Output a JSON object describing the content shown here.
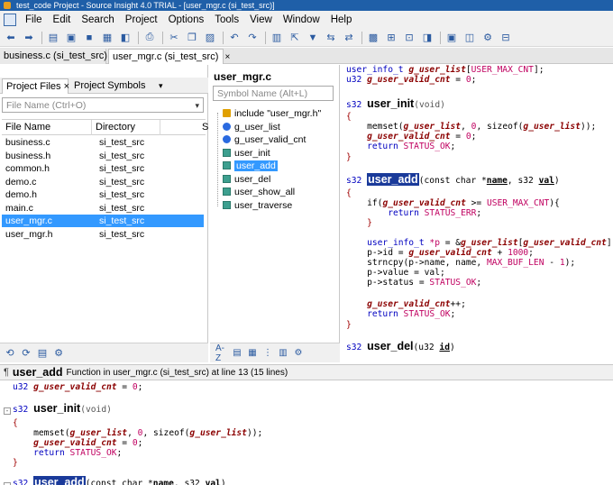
{
  "window": {
    "title": "test_code Project - Source Insight 4.0 TRIAL - [user_mgr.c (si_test_src)]"
  },
  "menu": [
    "File",
    "Edit",
    "Search",
    "Project",
    "Options",
    "Tools",
    "View",
    "Window",
    "Help"
  ],
  "toolbar_icons": [
    "back-icon",
    "forward-icon",
    "new-file-icon",
    "open-folder-icon",
    "save-icon",
    "save-all-icon",
    "close-file-icon",
    "print-icon",
    "cut-icon",
    "copy-icon",
    "paste-icon",
    "undo-icon",
    "redo-icon",
    "symbol-window-icon",
    "jump-icon",
    "bookmark-icon",
    "replace-icon",
    "browse-icon",
    "lookup-icon",
    "relation-icon",
    "sync-icon",
    "context-icon",
    "project-icon",
    "options-icon",
    "settings-icon",
    "layout-icon"
  ],
  "file_tabs": [
    {
      "label": "business.c (si_test_src)"
    },
    {
      "label": "user_mgr.c (si_test_src)",
      "close": "×"
    }
  ],
  "left_panel": {
    "tabs": {
      "project_files": "Project Files",
      "close": "×",
      "project_symbols": "Project Symbols",
      "more": "▾"
    },
    "search_placeholder": "File Name (Ctrl+O)",
    "dropdown": "▾",
    "columns": {
      "name": "File Name",
      "directory": "Directory",
      "s": "S"
    },
    "files": [
      {
        "name": "business.c",
        "dir": "si_test_src"
      },
      {
        "name": "business.h",
        "dir": "si_test_src"
      },
      {
        "name": "common.h",
        "dir": "si_test_src"
      },
      {
        "name": "demo.c",
        "dir": "si_test_src"
      },
      {
        "name": "demo.h",
        "dir": "si_test_src"
      },
      {
        "name": "main.c",
        "dir": "si_test_src"
      },
      {
        "name": "user_mgr.c",
        "dir": "si_test_src"
      },
      {
        "name": "user_mgr.h",
        "dir": "si_test_src"
      }
    ],
    "selected_index": 6
  },
  "symbol_panel": {
    "title": "user_mgr.c",
    "search_placeholder": "Symbol Name (Alt+L)",
    "symbols": [
      {
        "label": "include \"user_mgr.h\"",
        "kind": "include"
      },
      {
        "label": "g_user_list",
        "kind": "var"
      },
      {
        "label": "g_user_valid_cnt",
        "kind": "var"
      },
      {
        "label": "user_init",
        "kind": "fn"
      },
      {
        "label": "user_add",
        "kind": "fn"
      },
      {
        "label": "user_del",
        "kind": "fn"
      },
      {
        "label": "user_show_all",
        "kind": "fn"
      },
      {
        "label": "user_traverse",
        "kind": "fn"
      }
    ],
    "selected_index": 4,
    "sort_label": "A-Z"
  },
  "code": {
    "l1a": "user_info_t ",
    "l1b": "g_user_list",
    "l1c": "[",
    "l1d": "USER_MAX_CNT",
    "l1e": "];",
    "l2a": "u32 ",
    "l2b": "g_user_valid_cnt",
    "l2c": " = ",
    "l2d": "0",
    "l2e": ";",
    "init_ret": "s32 ",
    "init_name": "user_init",
    "init_params": "(void)",
    "ob": "{",
    "cb": "}",
    "m1a": "    memset(",
    "m1b": "g_user_list",
    "m1c": ", ",
    "m1d": "0",
    "m1e": ", sizeof(",
    "m1f": "g_user_list",
    "m1g": "));",
    "m2a": "    ",
    "m2b": "g_user_valid_cnt",
    "m2c": " = ",
    "m2d": "0",
    "m2e": ";",
    "m3a": "    return ",
    "m3b": "STATUS_OK",
    "m3c": ";",
    "add_ret": "s32 ",
    "add_name": "user_add",
    "add_p1": "(const char *",
    "add_p2": "name",
    "add_p3": ", s32 ",
    "add_p4": "val",
    "add_p5": ")",
    "a1a": "    if(",
    "a1b": "g_user_valid_cnt",
    "a1c": " >= ",
    "a1d": "USER_MAX_CNT",
    "a1e": "){",
    "a2a": "        return ",
    "a2b": "STATUS_ERR",
    "a2c": ";",
    "a3": "    }",
    "a4a": "    user_info_t ",
    "a4b": "*p",
    "a4c": " = &",
    "a4d": "g_user_list",
    "a4e": "[",
    "a4f": "g_user_valid_cnt",
    "a4g": "];",
    "a5a": "    p->id = ",
    "a5b": "g_user_valid_cnt",
    "a5c": " + ",
    "a5d": "1000",
    "a5e": ";",
    "a6a": "    strncpy(p->name, name, ",
    "a6b": "MAX_BUF_LEN",
    "a6c": " - ",
    "a6d": "1",
    "a6e": ");",
    "a7": "    p->value = val;",
    "a8a": "    p->status = ",
    "a8b": "STATUS_OK",
    "a8c": ";",
    "a9a": "    ",
    "a9b": "g_user_valid_cnt",
    "a9c": "++;",
    "a10a": "    return ",
    "a10b": "STATUS_OK",
    "a10c": ";",
    "del_ret": "s32 ",
    "del_name": "user_del",
    "del_p1": "(u32 ",
    "del_p2": "id",
    "del_p3": ")"
  },
  "context": {
    "icon": "¶",
    "name": "user_add",
    "info": "Function in user_mgr.c (si_test_src) at line 13 (15 lines)",
    "fold": "-"
  }
}
